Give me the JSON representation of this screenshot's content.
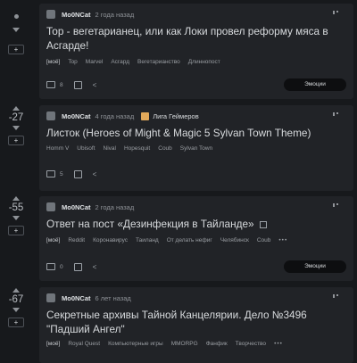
{
  "posts": [
    {
      "rating": "",
      "author": "Mo0NCat",
      "time": "2 года назад",
      "community": "",
      "title": "Тор - вегетарианец, или  как Локи провел реформу мяса в Асгарде!",
      "tags": [
        "[моё]",
        "Top",
        "Marvel",
        "Асгард",
        "Вегетарианство",
        "Длиннопост"
      ],
      "comments": "8",
      "emoji_label": "Эмоции"
    },
    {
      "rating": "-27",
      "author": "Mo0NCat",
      "time": "4 года назад",
      "community": "Лига Геймеров",
      "title": "Листок (Heroes of Might & Magic 5 Sylvan Town Theme)",
      "tags": [
        "Homm V",
        "Ubisoft",
        "Nival",
        "Hopesquit",
        "Coub",
        "Sylvan Town"
      ],
      "comments": "5",
      "emoji_label": ""
    },
    {
      "rating": "-55",
      "author": "Mo0NCat",
      "time": "2 года назад",
      "community": "",
      "title": "Ответ на пост «Дезинфекция в Тайланде»",
      "tags": [
        "[моё]",
        "Reddit",
        "Коронавирус",
        "Таиланд",
        "От делать нефиг",
        "Челябинск",
        "Coub"
      ],
      "comments": "0",
      "emoji_label": "Эмоции"
    },
    {
      "rating": "-67",
      "author": "Mo0NCat",
      "time": "6 лет назад",
      "community": "",
      "title": "Секретные архивы Тайной Канцелярии. Дело №3496 \"Падший Ангел\"",
      "tags": [
        "[моё]",
        "Royal Quest",
        "Компьютерные игры",
        "MMORPG",
        "Фанфик",
        "Творчество"
      ],
      "comments": "",
      "emoji_label": ""
    }
  ],
  "plus_label": "+",
  "more_dots": "•••"
}
